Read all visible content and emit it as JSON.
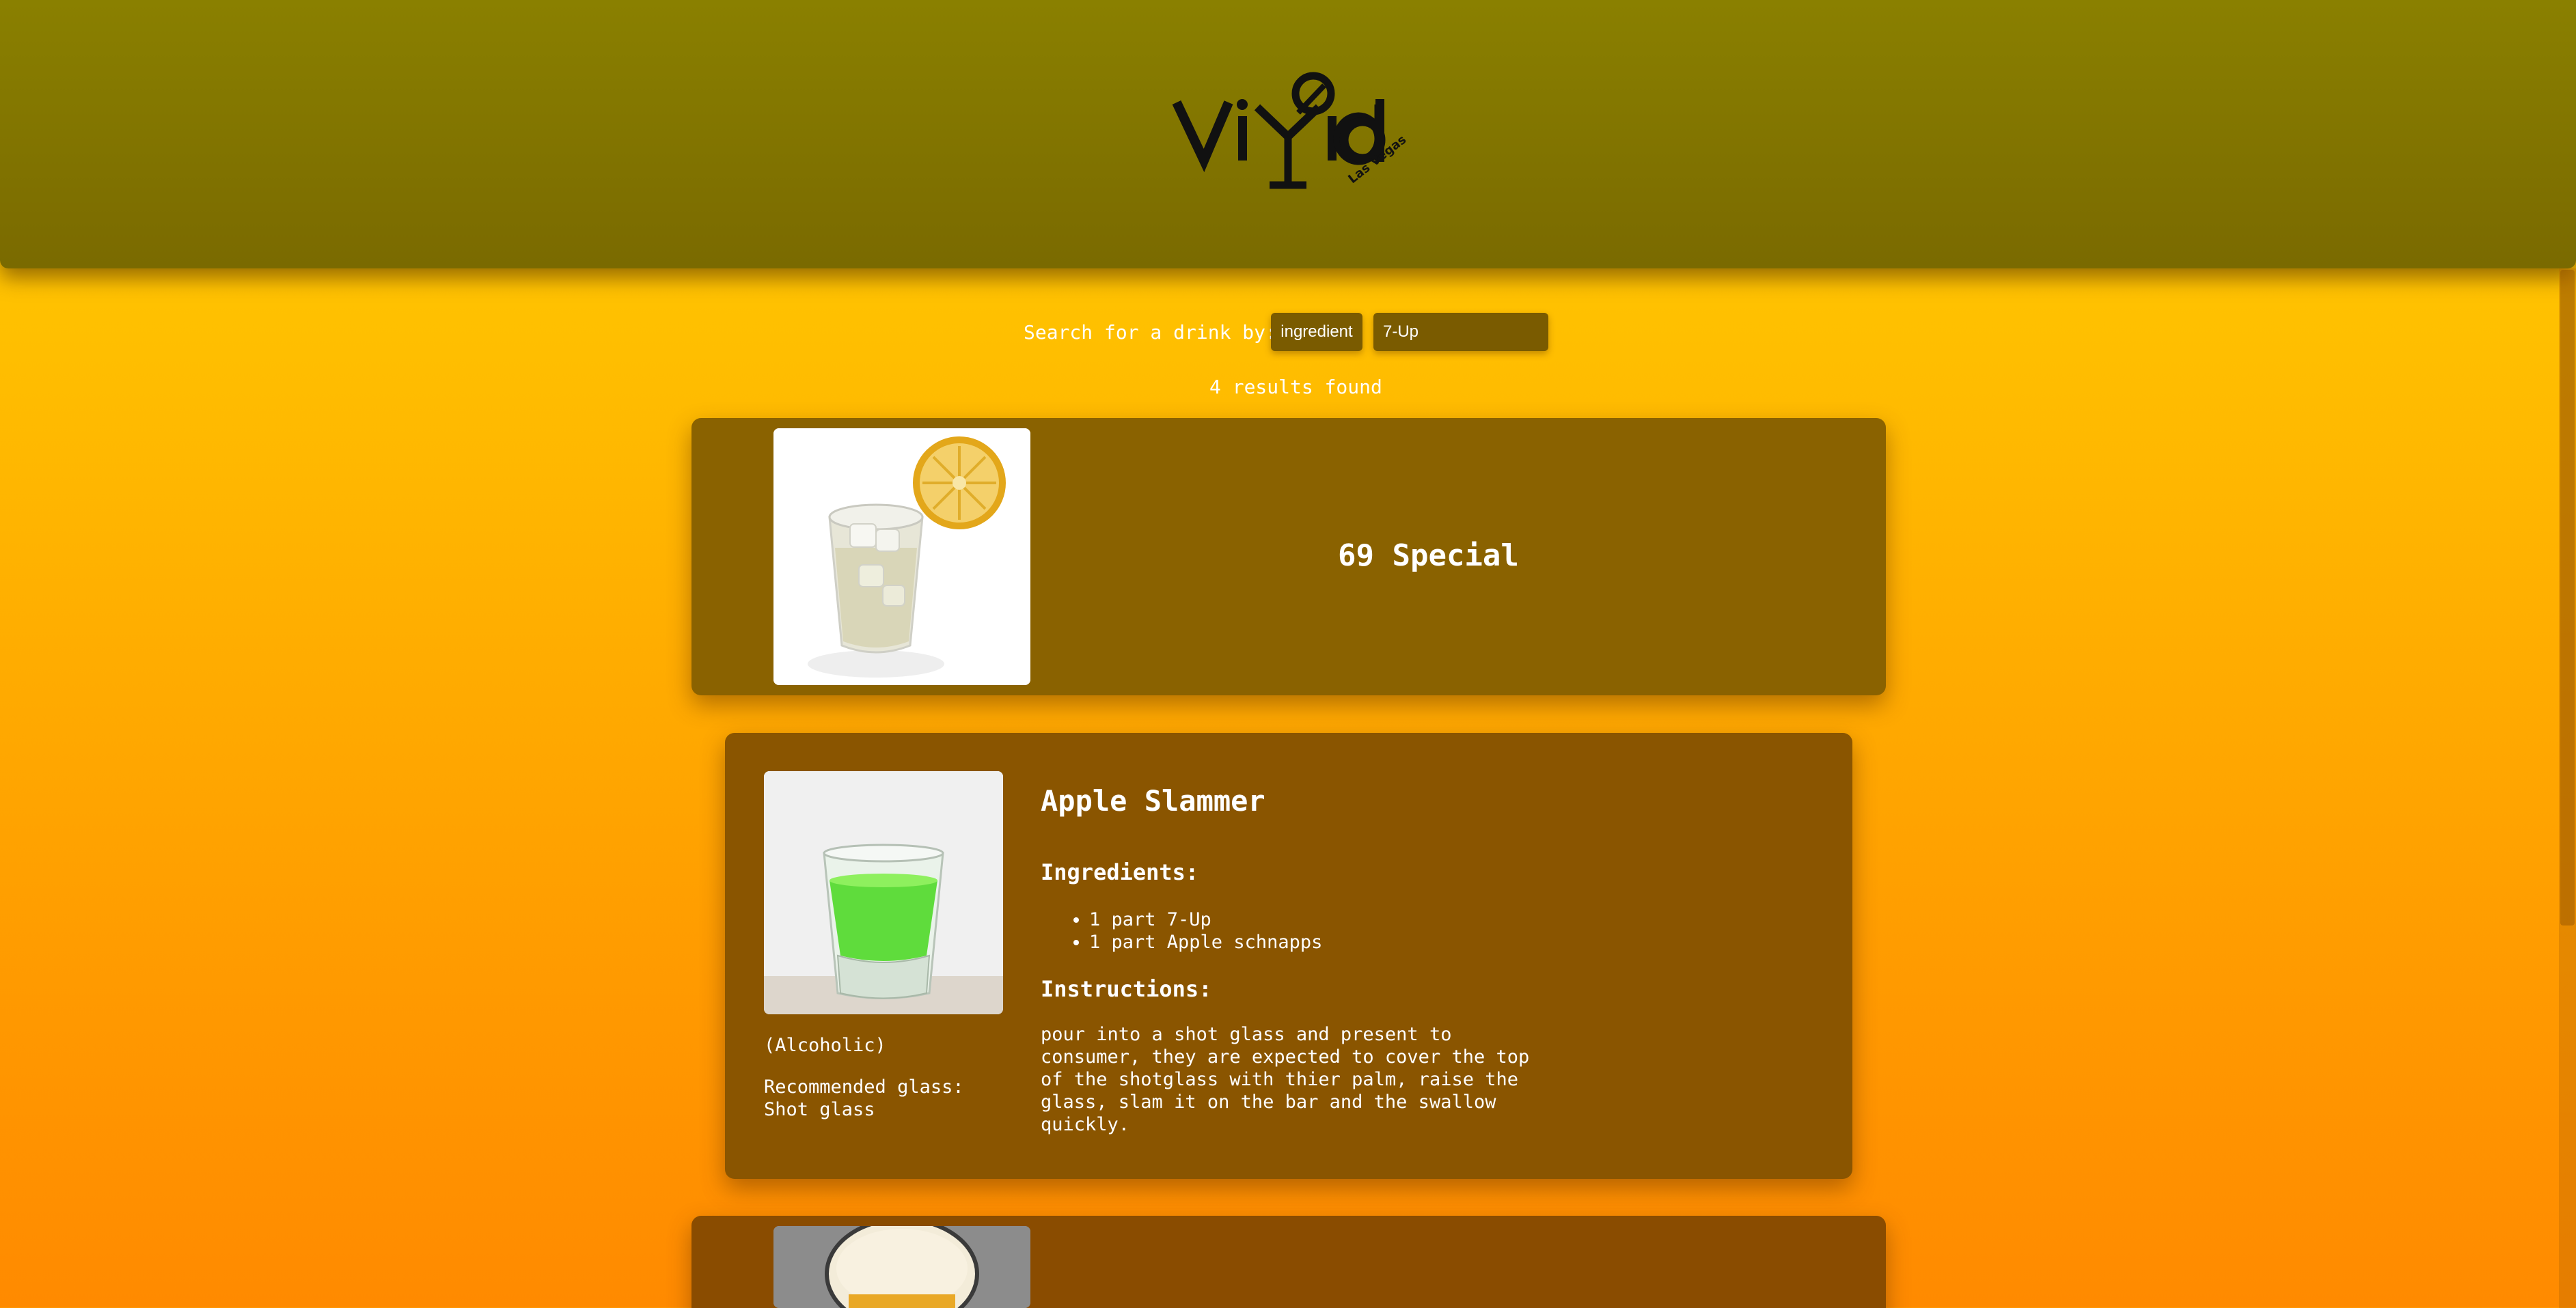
{
  "header": {
    "logo_text": "Vi d",
    "logo_subtext": "Las Vegas"
  },
  "search": {
    "label": "Search for a drink by:",
    "filter_value": "ingredient",
    "query_value": "7-Up"
  },
  "results": {
    "count_text": "4 results found"
  },
  "drinks": [
    {
      "name": "69 Special",
      "image": "lemon-highball-glass"
    },
    {
      "name": "Apple Slammer",
      "image": "green-shot-glass",
      "ingredients_heading": "Ingredients:",
      "ingredients": [
        "1 part 7-Up",
        "1 part Apple schnapps"
      ],
      "instructions_heading": "Instructions:",
      "instructions": "pour into a shot glass and present to consumer, they are expected to cover the top of the shotglass with thier palm, raise the glass, slam it on the bar and the swallow quickly.",
      "category": "(Alcoholic)",
      "glass_label": "Recommended glass:",
      "glass_value": "Shot glass"
    },
    {
      "image": "beer-foam-glass"
    }
  ],
  "colors": {
    "header_bg": "#8a8000",
    "page_gradient_top": "#ffd300",
    "page_gradient_bottom": "#ff8a00",
    "card_bg": "#8a5500",
    "text": "#ffffff"
  }
}
